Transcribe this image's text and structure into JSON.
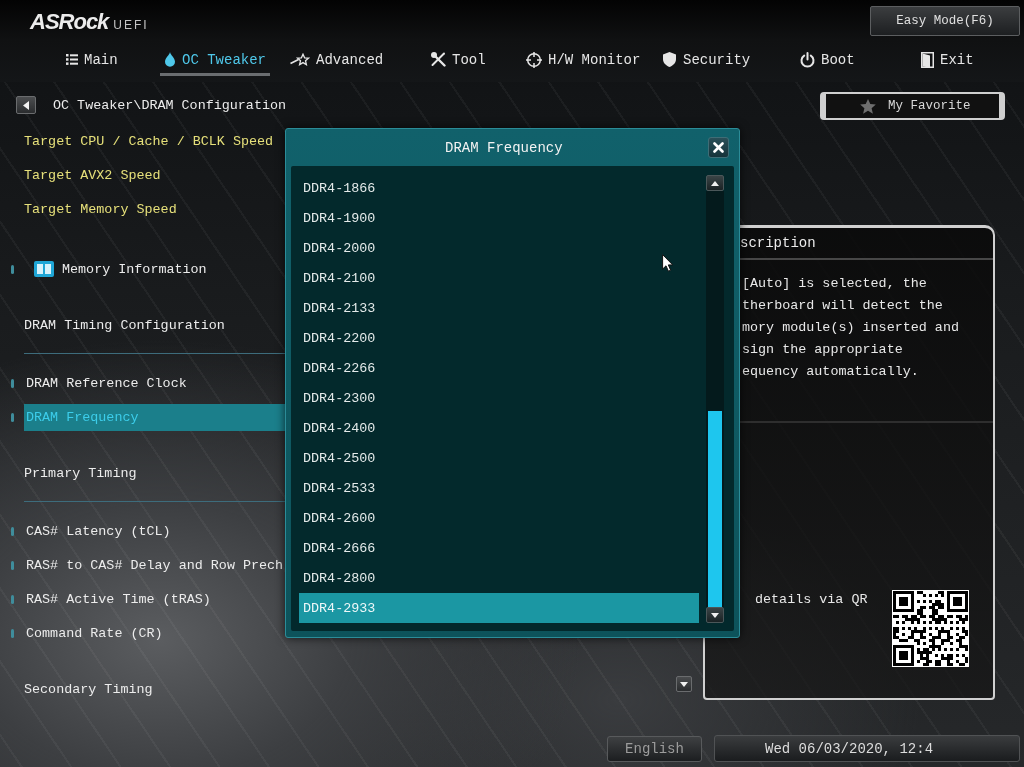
{
  "header": {
    "logo": "ASRock",
    "logo_suffix": "UEFI",
    "easy_mode_button": "Easy Mode(F6)"
  },
  "tabs": [
    {
      "label": "Main",
      "selected": false
    },
    {
      "label": "OC Tweaker",
      "selected": true
    },
    {
      "label": "Advanced",
      "selected": false
    },
    {
      "label": "Tool",
      "selected": false
    },
    {
      "label": "H/W Monitor",
      "selected": false
    },
    {
      "label": "Security",
      "selected": false
    },
    {
      "label": "Boot",
      "selected": false
    },
    {
      "label": "Exit",
      "selected": false
    }
  ],
  "breadcrumb": "OC Tweaker\\DRAM Configuration",
  "settings": [
    {
      "kind": "info",
      "label": "Target CPU / Cache / BCLK Speed"
    },
    {
      "kind": "info",
      "label": "Target AVX2 Speed"
    },
    {
      "kind": "info",
      "label": "Target Memory Speed"
    },
    {
      "kind": "submenu",
      "label": "Memory Information",
      "selected": false
    },
    {
      "kind": "section",
      "label": "DRAM Timing Configuration"
    },
    {
      "kind": "item",
      "label": "DRAM Reference Clock",
      "selected": false
    },
    {
      "kind": "item",
      "label": "DRAM Frequency",
      "selected": true
    },
    {
      "kind": "section",
      "label": "Primary Timing"
    },
    {
      "kind": "item",
      "label": "CAS# Latency (tCL)",
      "selected": false
    },
    {
      "kind": "item",
      "label": "RAS# to CAS# Delay and Row Prech",
      "selected": false
    },
    {
      "kind": "item",
      "label": "RAS# Active Time (tRAS)",
      "selected": false
    },
    {
      "kind": "item",
      "label": "Command Rate (CR)",
      "selected": false
    },
    {
      "kind": "section",
      "label": "Secondary Timing"
    }
  ],
  "favorite_button": "My Favorite",
  "description": {
    "title": "scription",
    "lines": [
      "[Auto] is selected, the",
      "therboard will detect the",
      "mory module(s) inserted and",
      "sign the appropriate",
      "equency automatically."
    ],
    "qr_caption": "details via QR"
  },
  "footer": {
    "language": "English",
    "datetime": "Wed 06/03/2020, 12:4"
  },
  "dialog": {
    "title": "DRAM Frequency",
    "options": [
      {
        "label": "DDR4-1866",
        "selected": false
      },
      {
        "label": "DDR4-1900",
        "selected": false
      },
      {
        "label": "DDR4-2000",
        "selected": false
      },
      {
        "label": "DDR4-2100",
        "selected": false
      },
      {
        "label": "DDR4-2133",
        "selected": false
      },
      {
        "label": "DDR4-2200",
        "selected": false
      },
      {
        "label": "DDR4-2266",
        "selected": false
      },
      {
        "label": "DDR4-2300",
        "selected": false
      },
      {
        "label": "DDR4-2400",
        "selected": false
      },
      {
        "label": "DDR4-2500",
        "selected": false
      },
      {
        "label": "DDR4-2533",
        "selected": false
      },
      {
        "label": "DDR4-2600",
        "selected": false
      },
      {
        "label": "DDR4-2666",
        "selected": false
      },
      {
        "label": "DDR4-2800",
        "selected": false
      },
      {
        "label": "DDR4-2933",
        "selected": true
      }
    ]
  }
}
